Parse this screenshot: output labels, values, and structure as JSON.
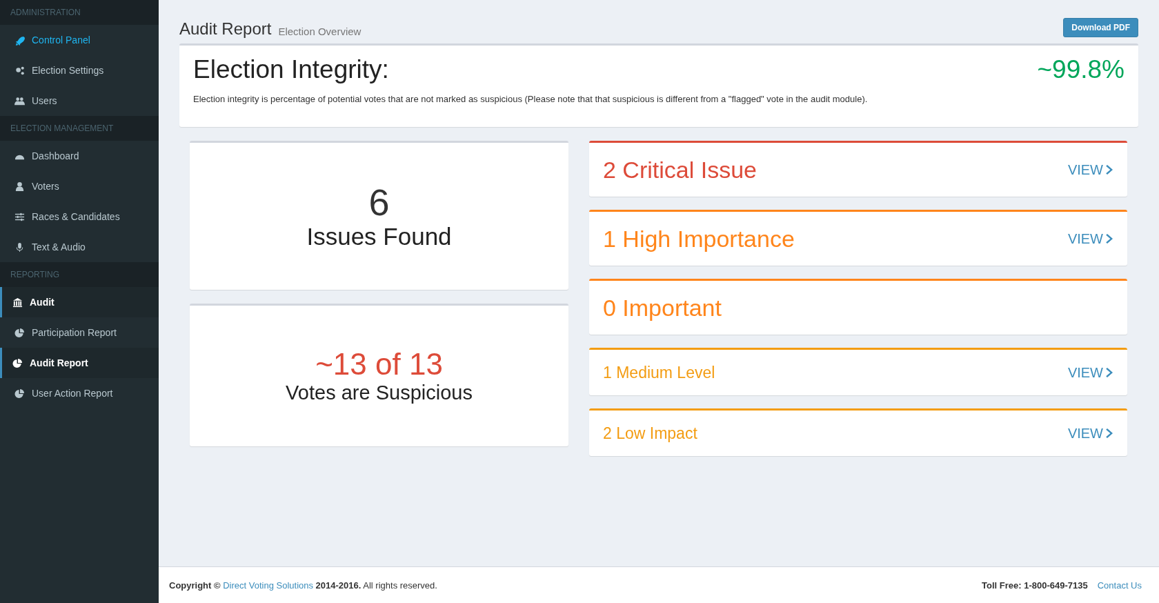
{
  "sidebar": {
    "sections": [
      {
        "title": "ADMINISTRATION",
        "items": [
          {
            "label": "Control Panel",
            "highlighted": true,
            "selected": false
          },
          {
            "label": "Election Settings",
            "highlighted": false,
            "selected": false
          },
          {
            "label": "Users",
            "highlighted": false,
            "selected": false
          }
        ]
      },
      {
        "title": "ELECTION MANAGEMENT",
        "items": [
          {
            "label": "Dashboard",
            "highlighted": false,
            "selected": false
          },
          {
            "label": "Voters",
            "highlighted": false,
            "selected": false
          },
          {
            "label": "Races & Candidates",
            "highlighted": false,
            "selected": false
          },
          {
            "label": "Text & Audio",
            "highlighted": false,
            "selected": false
          }
        ]
      },
      {
        "title": "REPORTING",
        "items": [
          {
            "label": "Audit",
            "highlighted": false,
            "selected": true
          },
          {
            "label": "Participation Report",
            "highlighted": false,
            "selected": false
          },
          {
            "label": "Audit Report",
            "highlighted": false,
            "selected": true
          },
          {
            "label": "User Action Report",
            "highlighted": false,
            "selected": false
          }
        ]
      }
    ]
  },
  "header": {
    "title": "Audit Report",
    "subtitle": "Election Overview",
    "button": "Download PDF"
  },
  "integrity": {
    "title": "Election Integrity:",
    "value": "~99.8%",
    "description": "Election integrity is percentage of potential votes that are not marked as suspicious (Please note that that suspicious is different from a \"flagged\" vote in the audit module)."
  },
  "stats": [
    {
      "value": "6",
      "label": "Issues Found",
      "color": "#333333",
      "kind": "big"
    },
    {
      "value": "~13 of 13",
      "label": "Votes are Suspicious",
      "color": "#dd4b39",
      "kind": "medium"
    }
  ],
  "issues": [
    {
      "label": "2 Critical Issue",
      "color": "#dd4b39",
      "kind": "major",
      "link": "VIEW"
    },
    {
      "label": "1 High Importance",
      "color": "#ff851b",
      "kind": "major",
      "link": "VIEW"
    },
    {
      "label": "0 Important",
      "color": "#ff851b",
      "kind": "major"
    },
    {
      "label": "1 Medium Level",
      "color": "#f39c12",
      "kind": "minor",
      "link": "VIEW"
    },
    {
      "label": "2 Low Impact",
      "color": "#f39c12",
      "kind": "minor",
      "link": "VIEW"
    }
  ],
  "footer": {
    "copyright": "Copyright ©",
    "company": "Direct Voting Solutions",
    "years": "2014-2016.",
    "rights": "All rights reserved.",
    "phone": "Toll Free: 1-800-649-7135",
    "contact": "Contact Us"
  }
}
